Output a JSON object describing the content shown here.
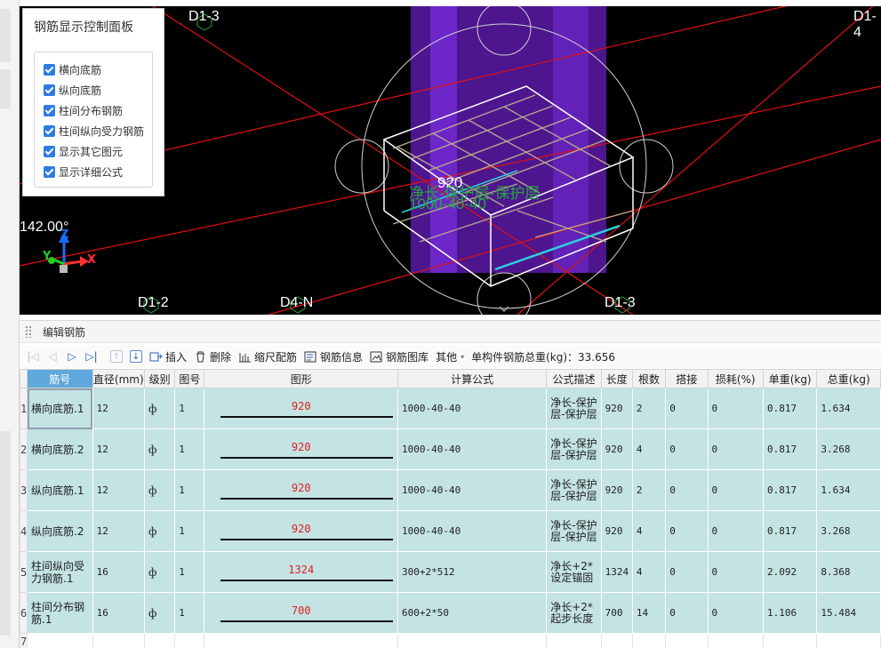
{
  "viewport": {
    "axis_labels": [
      "D1-3",
      "D1-4",
      "D1-2",
      "D4-N",
      "D1-3"
    ],
    "angle": "142.00°",
    "dimension_value": "920",
    "dimension_formula_line1": "净长-保护层-保护层",
    "dimension_formula_line2": "1000-40-40",
    "axis_x": "X",
    "axis_y": "Y",
    "axis_z": "Z",
    "colors": {
      "background": "#000000",
      "column": "#6a1fc0",
      "gridline": "#e01010",
      "rebar_highlight": "#2bd2e0"
    }
  },
  "control_panel": {
    "title": "钢筋显示控制面板",
    "options": [
      {
        "label": "横向底筋",
        "checked": true
      },
      {
        "label": "纵向底筋",
        "checked": true
      },
      {
        "label": "柱间分布钢筋",
        "checked": true
      },
      {
        "label": "柱间纵向受力钢筋",
        "checked": true
      },
      {
        "label": "显示其它图元",
        "checked": true
      },
      {
        "label": "显示详细公式",
        "checked": true
      }
    ]
  },
  "editor": {
    "title": "编辑钢筋",
    "toolbar": {
      "insert": "插入",
      "delete": "删除",
      "scale_rebar": "缩尺配筋",
      "rebar_info": "钢筋信息",
      "rebar_library": "钢筋图库",
      "other": "其他",
      "total_weight": "单构件钢筋总重(kg)：33.656"
    },
    "columns": [
      "筋号",
      "直径(mm)",
      "级别",
      "图号",
      "图形",
      "计算公式",
      "公式描述",
      "长度",
      "根数",
      "搭接",
      "损耗(%)",
      "单重(kg)",
      "总重(kg)"
    ],
    "rows": [
      {
        "num": "1",
        "name": "横向底筋.1",
        "diameter": "12",
        "grade": "ф",
        "fig": "1",
        "shape": "920",
        "formula": "1000-40-40",
        "desc": "净长-保护层-保护层",
        "length": "920",
        "count": "2",
        "lap": "0",
        "loss": "0",
        "unit_w": "0.817",
        "total_w": "1.634"
      },
      {
        "num": "2",
        "name": "横向底筋.2",
        "diameter": "12",
        "grade": "ф",
        "fig": "1",
        "shape": "920",
        "formula": "1000-40-40",
        "desc": "净长-保护层-保护层",
        "length": "920",
        "count": "4",
        "lap": "0",
        "loss": "0",
        "unit_w": "0.817",
        "total_w": "3.268"
      },
      {
        "num": "3",
        "name": "纵向底筋.1",
        "diameter": "12",
        "grade": "ф",
        "fig": "1",
        "shape": "920",
        "formula": "1000-40-40",
        "desc": "净长-保护层-保护层",
        "length": "920",
        "count": "2",
        "lap": "0",
        "loss": "0",
        "unit_w": "0.817",
        "total_w": "1.634"
      },
      {
        "num": "4",
        "name": "纵向底筋.2",
        "diameter": "12",
        "grade": "ф",
        "fig": "1",
        "shape": "920",
        "formula": "1000-40-40",
        "desc": "净长-保护层-保护层",
        "length": "920",
        "count": "4",
        "lap": "0",
        "loss": "0",
        "unit_w": "0.817",
        "total_w": "3.268"
      },
      {
        "num": "5",
        "name": "柱间纵向受力钢筋.1",
        "diameter": "16",
        "grade": "ф",
        "fig": "1",
        "shape": "1324",
        "formula": "300+2*512",
        "desc": "净长+2*设定锚固",
        "length": "1324",
        "count": "4",
        "lap": "0",
        "loss": "0",
        "unit_w": "2.092",
        "total_w": "8.368"
      },
      {
        "num": "6",
        "name": "柱间分布钢筋.1",
        "diameter": "16",
        "grade": "ф",
        "fig": "1",
        "shape": "700",
        "formula": "600+2*50",
        "desc": "净长+2*起步长度",
        "length": "700",
        "count": "14",
        "lap": "0",
        "loss": "0",
        "unit_w": "1.106",
        "total_w": "15.484"
      }
    ],
    "empty_row_num": "7"
  }
}
